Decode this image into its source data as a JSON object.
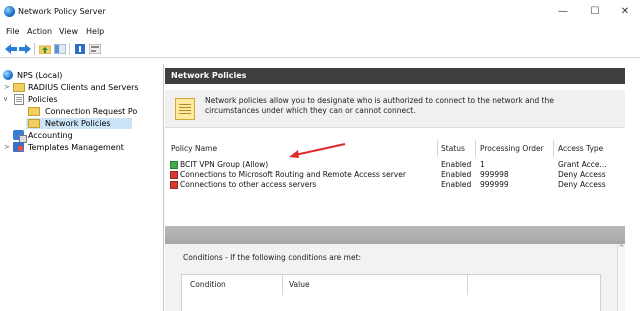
{
  "window": {
    "title": "Network Policy Server",
    "controls": {
      "minimize": "—",
      "maximize": "☐",
      "close": "✕"
    }
  },
  "menu": [
    "File",
    "Action",
    "View",
    "Help"
  ],
  "toolbar": {
    "icons": [
      "back-icon",
      "forward-icon",
      "folder-up-icon",
      "show-hide-tree-icon",
      "help-icon",
      "properties-icon"
    ]
  },
  "tree": {
    "items": [
      {
        "label": "NPS (Local)",
        "icon": "globe-icon"
      },
      {
        "label": "RADIUS Clients and Servers",
        "icon": "folder-icon"
      },
      {
        "label": "Policies",
        "icon": "document-icon"
      },
      {
        "label": "Connection Request Po",
        "icon": "folder-icon"
      },
      {
        "label": "Network Policies",
        "icon": "folder-icon",
        "selected": true
      },
      {
        "label": "Accounting",
        "icon": "accounting-icon"
      },
      {
        "label": "Templates Management",
        "icon": "templates-icon"
      }
    ],
    "arrows": {
      "collapsed": ">",
      "expanded": "∨"
    }
  },
  "main": {
    "header": "Network Policies",
    "description_line1": "Network policies allow you to designate who is authorized to connect to the network and the",
    "description_line2": "circumstances under which they can or cannot connect.",
    "columns": [
      "Policy Name",
      "Status",
      "Processing Order",
      "Access Type"
    ],
    "rows": [
      {
        "name": "BCIT VPN Group (Allow)",
        "status": "Enabled",
        "order": "1",
        "access": "Grant Acce...",
        "type": "allow"
      },
      {
        "name": "Connections to Microsoft Routing and Remote Access server",
        "status": "Enabled",
        "order": "999998",
        "access": "Deny Access",
        "type": "deny"
      },
      {
        "name": "Connections to other access servers",
        "status": "Enabled",
        "order": "999999",
        "access": "Deny Access",
        "type": "deny"
      }
    ],
    "conditions_title": "Conditions - If the following conditions are met:",
    "conditions_columns": [
      "Condition",
      "Value"
    ],
    "scroll_up": "^"
  },
  "colors": {
    "header_bg": "#3f3f3f",
    "selected_bg": "#cce4f7",
    "annotation_arrow": "#e02a2a",
    "allow_icon": "#3fae49",
    "deny_icon": "#d63b32"
  }
}
